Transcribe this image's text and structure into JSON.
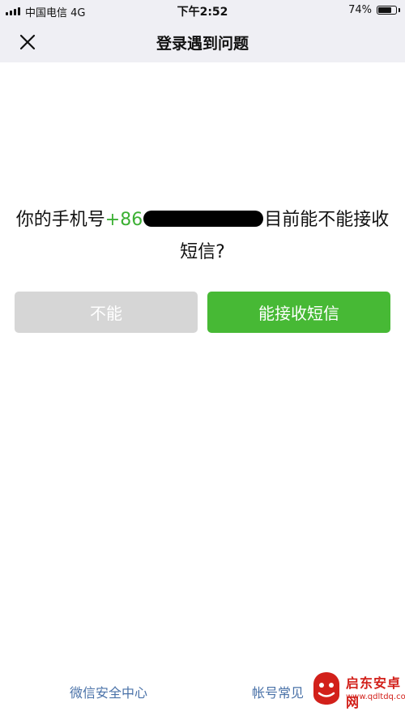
{
  "status_bar": {
    "carrier": "中国电信  4G",
    "time": "下午2:52",
    "battery_pct": "74%",
    "battery_level": 0.74
  },
  "nav": {
    "title": "登录遇到问题",
    "close_icon": "close-icon"
  },
  "question": {
    "prefix": "你的手机号",
    "phone_visible": "+86",
    "suffix": "目前能不能接收短信?"
  },
  "buttons": {
    "cannot_label": "不能",
    "can_label": "能接收短信"
  },
  "footer": {
    "security_center": "微信安全中心",
    "account_faq": "帐号常见"
  },
  "watermark": {
    "text": "启东安卓网",
    "url": "www.qdltdq.com"
  },
  "colors": {
    "accent_green": "#47b935",
    "phone_green": "#3cb034",
    "disabled_gray": "#d6d6d6",
    "link_blue": "#4a72a8",
    "header_bg": "#efeff4"
  }
}
